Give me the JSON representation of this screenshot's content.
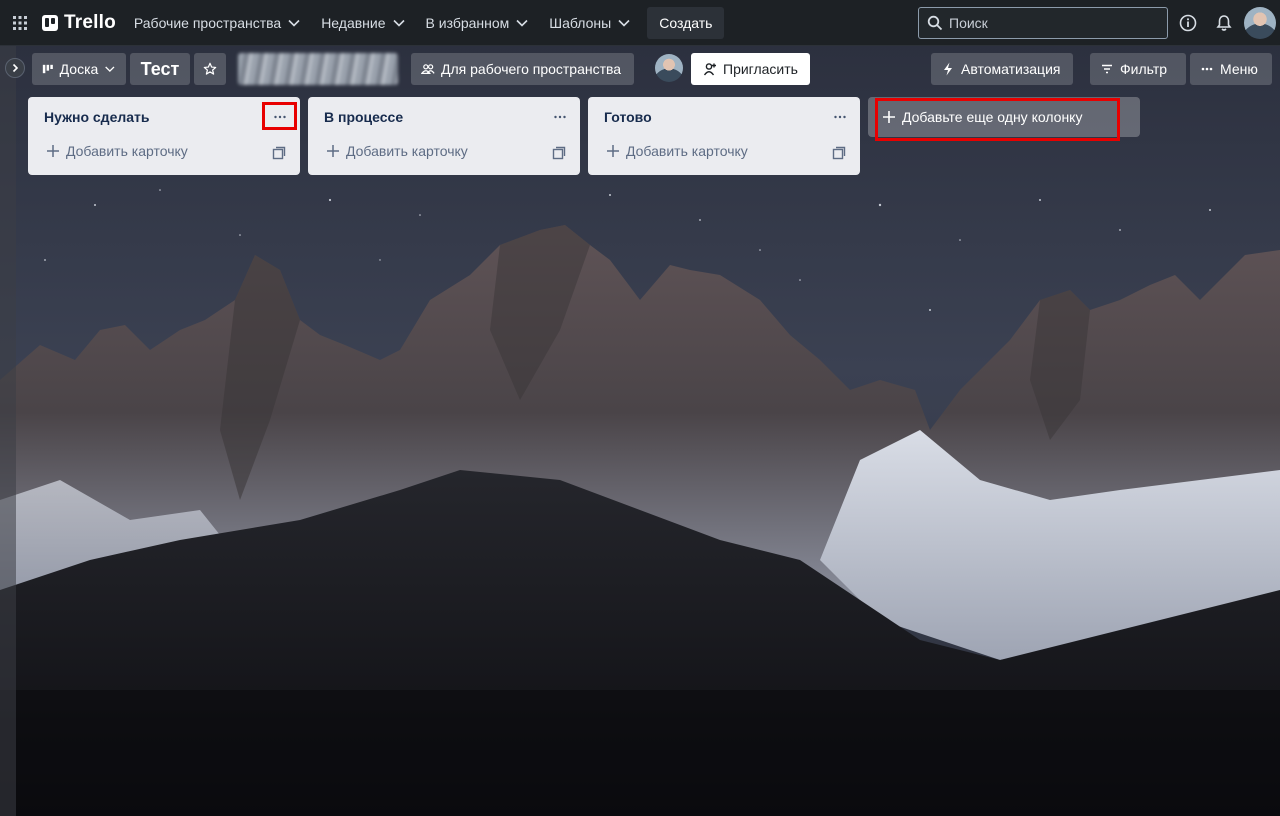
{
  "nav": {
    "logo_text": "Trello",
    "menu": [
      {
        "label": "Рабочие пространства"
      },
      {
        "label": "Недавние"
      },
      {
        "label": "В избранном"
      },
      {
        "label": "Шаблоны"
      }
    ],
    "create_label": "Создать",
    "search_placeholder": "Поиск"
  },
  "board": {
    "view_label": "Доска",
    "title": "Тест",
    "workspace_visibility_label": "Для рабочего пространства",
    "invite_label": "Пригласить",
    "automation_label": "Автоматизация",
    "filter_label": "Фильтр",
    "menu_label": "Меню"
  },
  "lists": [
    {
      "title": "Нужно сделать",
      "add_card_label": "Добавить карточку"
    },
    {
      "title": "В процессе",
      "add_card_label": "Добавить карточку"
    },
    {
      "title": "Готово",
      "add_card_label": "Добавить карточку"
    }
  ],
  "add_column_label": "Добавьте еще одну колонку",
  "colors": {
    "nav_bg": "#1d2125",
    "list_bg": "#ebecf0",
    "list_text": "#172b4d",
    "annotation": "#e80000"
  }
}
